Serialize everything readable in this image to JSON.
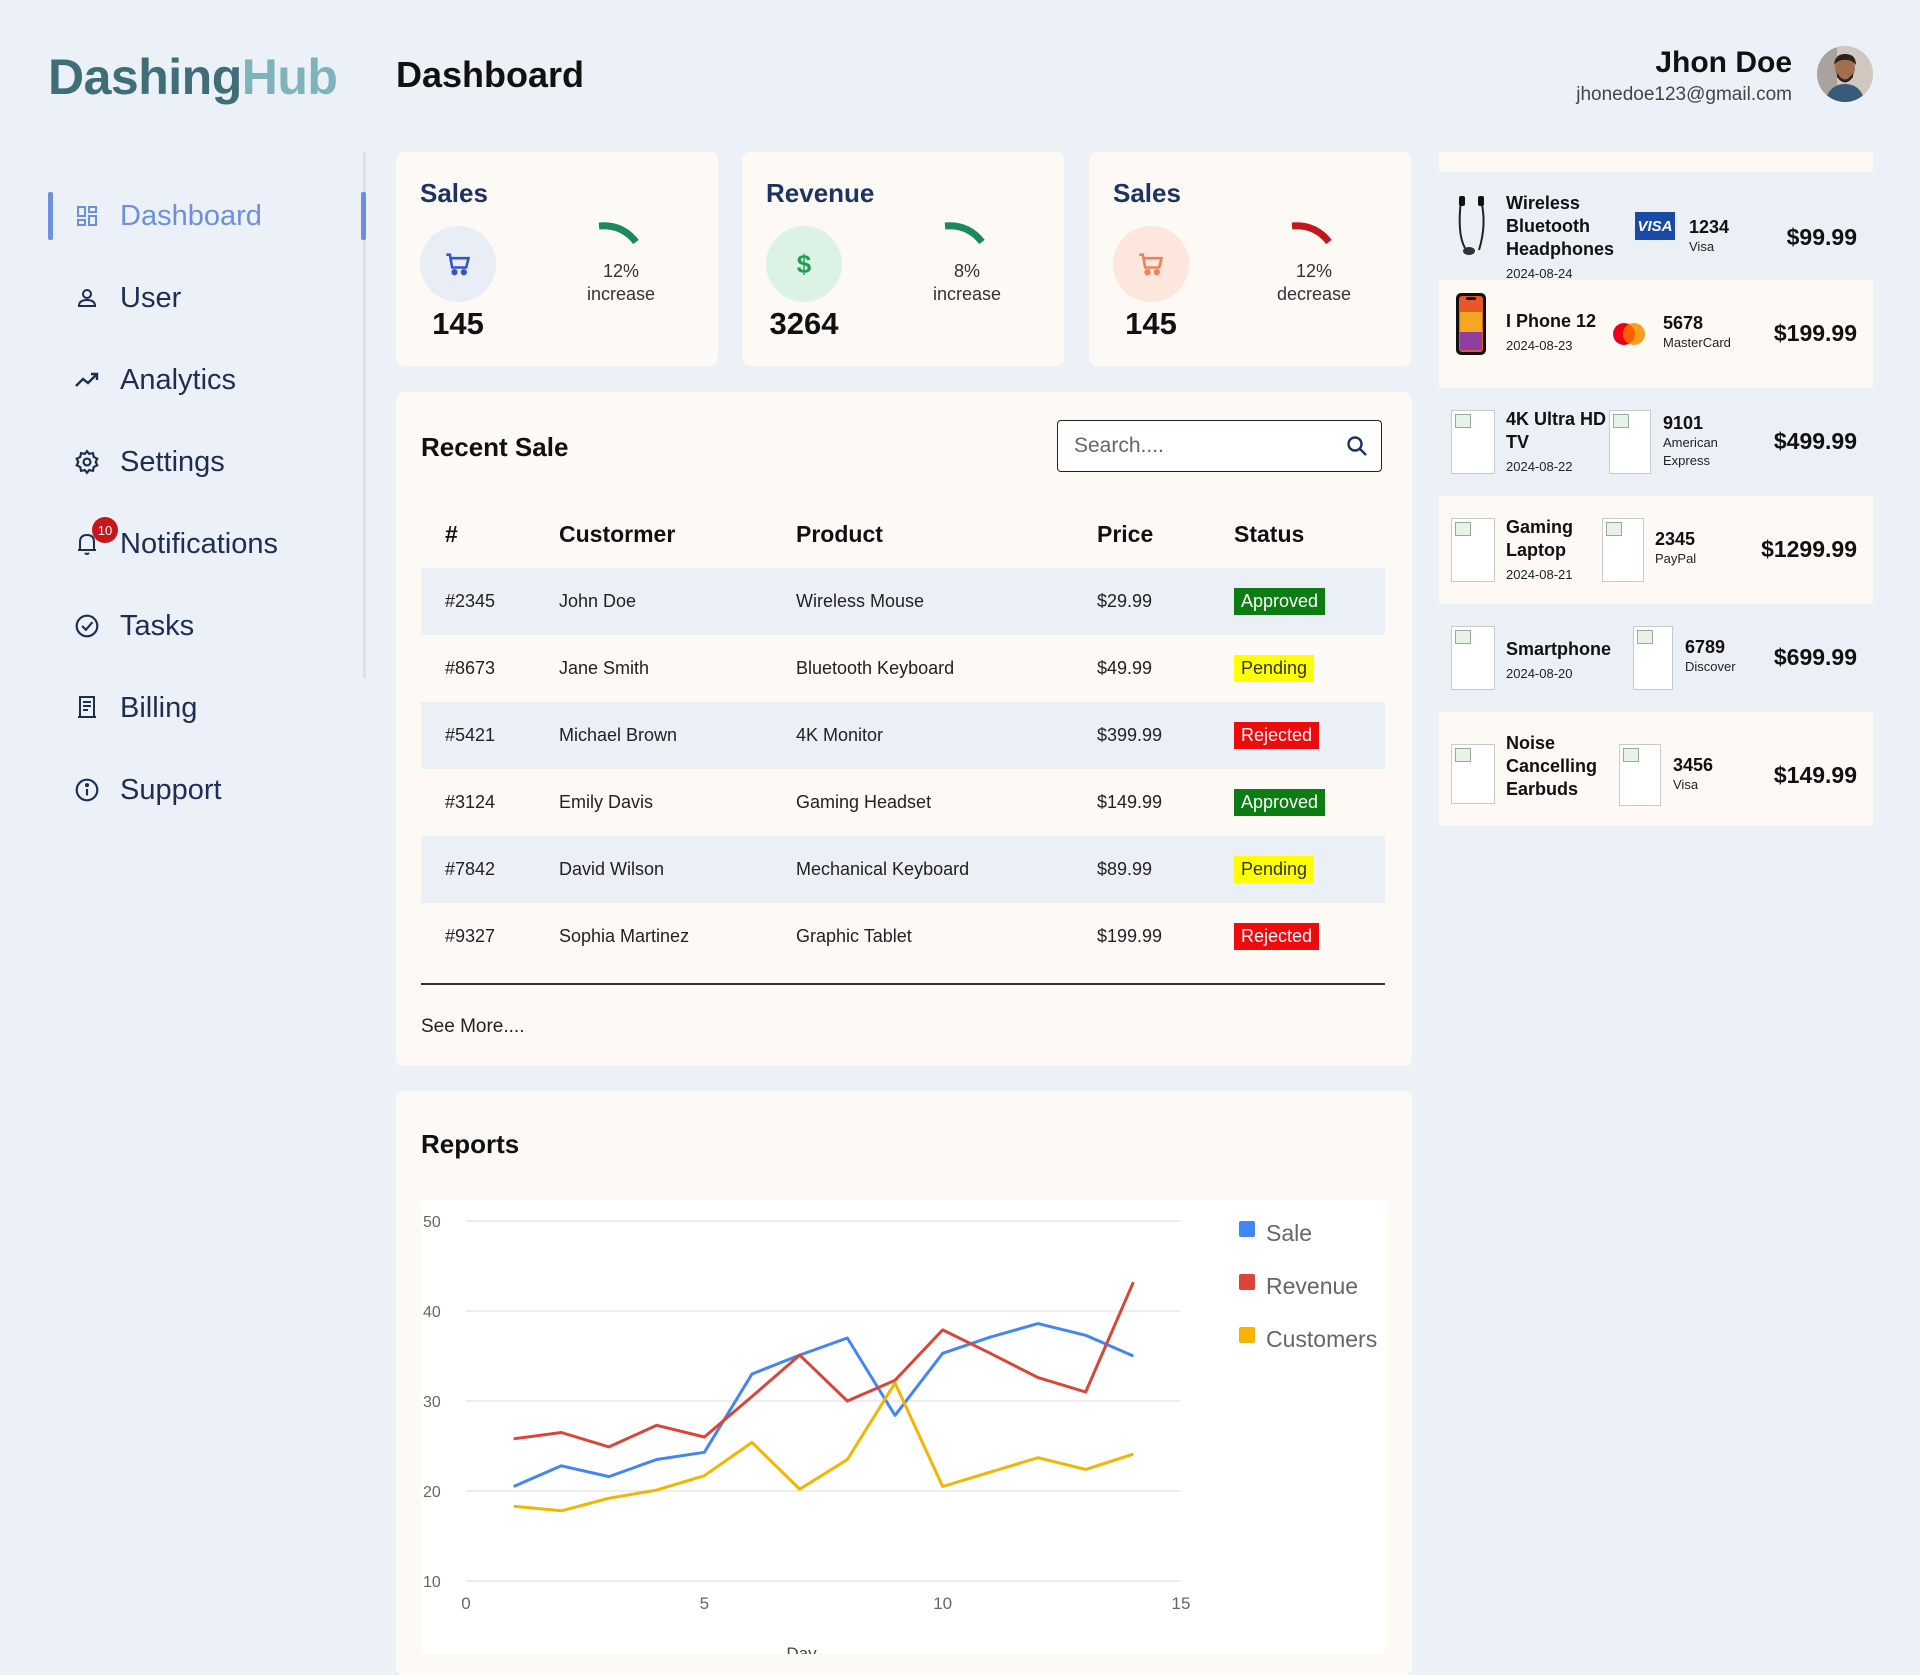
{
  "brand": {
    "part1": "Dashing",
    "part2": "Hub"
  },
  "page_title": "Dashboard",
  "user": {
    "name": "Jhon Doe",
    "email": "jhonedoe123@gmail.com"
  },
  "sidebar": {
    "items": [
      {
        "label": "Dashboard",
        "icon": "dashboard-icon"
      },
      {
        "label": "User",
        "icon": "user-icon"
      },
      {
        "label": "Analytics",
        "icon": "trending-up-icon"
      },
      {
        "label": "Settings",
        "icon": "gear-icon"
      },
      {
        "label": "Notifications",
        "icon": "bell-icon",
        "badge": "10"
      },
      {
        "label": "Tasks",
        "icon": "check-circle-icon"
      },
      {
        "label": "Billing",
        "icon": "receipt-icon"
      },
      {
        "label": "Support",
        "icon": "info-icon"
      }
    ]
  },
  "stats": [
    {
      "title": "Sales",
      "value": "145",
      "pct": "12%",
      "trend": "increase",
      "icon": "cart-icon",
      "color": "#1a8a5e",
      "circle": "#e8edf6",
      "icon_color": "#3454c7"
    },
    {
      "title": "Revenue",
      "value": "3264",
      "pct": "8%",
      "trend": "increase",
      "icon": "dollar-icon",
      "color": "#1a8a5e",
      "circle": "#dbf2e4",
      "icon_color": "#1f9d55"
    },
    {
      "title": "Sales",
      "value": "145",
      "pct": "12%",
      "trend": "decrease",
      "icon": "cart-icon",
      "color": "#c4161c",
      "circle": "#fde6dc",
      "icon_color": "#f0805a"
    }
  ],
  "recent_sale": {
    "title": "Recent Sale",
    "search_placeholder": "Search....",
    "headers": [
      "#",
      "Custormer",
      "Product",
      "Price",
      "Status"
    ],
    "rows": [
      [
        "#2345",
        "John Doe",
        "Wireless Mouse",
        "$29.99",
        "Approved"
      ],
      [
        "#8673",
        "Jane Smith",
        "Bluetooth Keyboard",
        "$49.99",
        "Pending"
      ],
      [
        "#5421",
        "Michael Brown",
        "4K Monitor",
        "$399.99",
        "Rejected"
      ],
      [
        "#3124",
        "Emily Davis",
        "Gaming Headset",
        "$149.99",
        "Approved"
      ],
      [
        "#7842",
        "David Wilson",
        "Mechanical Keyboard",
        "$89.99",
        "Pending"
      ],
      [
        "#9327",
        "Sophia Martinez",
        "Graphic Tablet",
        "$199.99",
        "Rejected"
      ]
    ],
    "see_more": "See More...."
  },
  "reports": {
    "title": "Reports"
  },
  "chart_data": {
    "type": "line",
    "xlabel": "Day",
    "ylabel": "",
    "xlim": [
      0,
      15
    ],
    "ylim": [
      10,
      50
    ],
    "xticks": [
      0,
      5,
      10,
      15
    ],
    "yticks": [
      10,
      20,
      30,
      40,
      50
    ],
    "grid": true,
    "legend_position": "right",
    "x": [
      1,
      2,
      3,
      4,
      5,
      6,
      7,
      8,
      9,
      10,
      11,
      12,
      13,
      14
    ],
    "series": [
      {
        "name": "Sale",
        "color": "#4285f4",
        "values": [
          20.5,
          22.8,
          21.6,
          23.5,
          24.3,
          33,
          35.1,
          37,
          28.4,
          35.3,
          37.1,
          38.6,
          37.3,
          35
        ]
      },
      {
        "name": "Revenue",
        "color": "#db4437",
        "values": [
          25.8,
          26.5,
          24.9,
          27.3,
          26,
          30.5,
          35.1,
          30,
          32.3,
          37.9,
          35.3,
          32.6,
          31,
          43.2
        ]
      },
      {
        "name": "Customers",
        "color": "#f4b400",
        "values": [
          18.3,
          17.8,
          19.2,
          20.1,
          21.7,
          25.4,
          20.2,
          23.5,
          32,
          20.5,
          22.1,
          23.7,
          22.4,
          24.1
        ]
      }
    ]
  },
  "products": [
    {
      "name": "Wireless Bluetooth Headphones",
      "date": "2024-08-24",
      "card_num": "1234",
      "card_type": "Visa",
      "price": "$99.99",
      "card_icon": "visa-icon",
      "img": "headphones-image"
    },
    {
      "name": "I Phone 12",
      "date": "2024-08-23",
      "card_num": "5678",
      "card_type": "MasterCard",
      "price": "$199.99",
      "card_icon": "mastercard-icon",
      "img": "phone-image"
    },
    {
      "name": "4K Ultra HD TV",
      "date": "2024-08-22",
      "card_num": "9101",
      "card_type": "American Express",
      "price": "$499.99",
      "card_icon": "broken-image-icon",
      "img": "broken-image-icon"
    },
    {
      "name": "Gaming Laptop",
      "date": "2024-08-21",
      "card_num": "2345",
      "card_type": "PayPal",
      "price": "$1299.99",
      "card_icon": "broken-image-icon",
      "img": "broken-image-icon"
    },
    {
      "name": "Smartphone",
      "date": "2024-08-20",
      "card_num": "6789",
      "card_type": "Discover",
      "price": "$699.99",
      "card_icon": "broken-image-icon",
      "img": "broken-image-icon"
    },
    {
      "name": "Noise Cancelling Earbuds",
      "date": "",
      "card_num": "3456",
      "card_type": "Visa",
      "price": "$149.99",
      "card_icon": "broken-image-icon",
      "img": "broken-image-icon"
    }
  ],
  "colors": {
    "background": "#ecf0f7",
    "card": "#fdfaf6",
    "accent": "#6d8fe0",
    "nav_text": "#1d2e52"
  }
}
